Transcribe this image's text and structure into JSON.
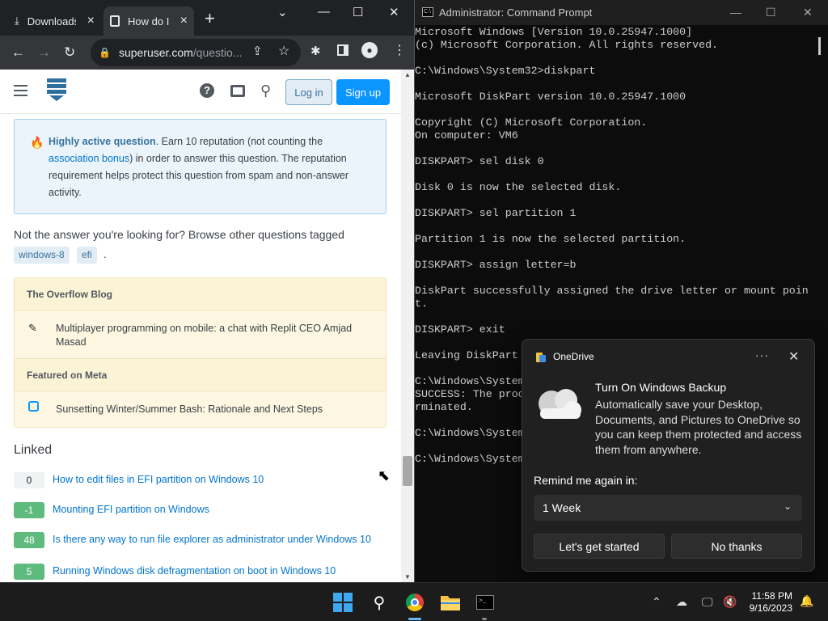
{
  "browser": {
    "tabs": [
      {
        "label": "Downloads",
        "icon": "download-icon"
      },
      {
        "label": "How do I",
        "icon": "superuser-icon"
      }
    ],
    "window_controls": {
      "minimize": "—",
      "maximize": "☐",
      "close": "✕"
    },
    "url": {
      "domain": "superuser.com",
      "path": "/questio..."
    }
  },
  "site_header": {
    "login": "Log in",
    "signup": "Sign up"
  },
  "notice": {
    "bold": "Highly active question",
    "text1": ". Earn 10 reputation (not counting the ",
    "link": "association bonus",
    "text2": ") in order to answer this question. The reputation requirement helps protect this question from spam and non-answer activity."
  },
  "browse": {
    "text": "Not the answer you're looking for? Browse other questions tagged",
    "tags": [
      "windows-8",
      "efi"
    ],
    "trailing": "."
  },
  "sidebar": {
    "blog_title": "The Overflow Blog",
    "blog_item": "Multiplayer programming on mobile: a chat with Replit CEO Amjad Masad",
    "meta_title": "Featured on Meta",
    "meta_item": "Sunsetting Winter/Summer Bash: Rationale and Next Steps"
  },
  "linked": {
    "heading": "Linked",
    "items": [
      {
        "score": "0",
        "title": "How to edit files in EFI partition on Windows 10"
      },
      {
        "score": "-1",
        "title": "Mounting EFI partition on Windows"
      },
      {
        "score": "48",
        "title": "Is there any way to run file explorer as administrator under Windows 10"
      },
      {
        "score": "5",
        "title": "Running Windows disk defragmentation on boot in Windows 10"
      }
    ]
  },
  "cmd": {
    "title": "Administrator: Command Prompt",
    "lines": [
      "Microsoft Windows [Version 10.0.25947.1000]",
      "(c) Microsoft Corporation. All rights reserved.",
      "",
      "C:\\Windows\\System32>diskpart",
      "",
      "Microsoft DiskPart version 10.0.25947.1000",
      "",
      "Copyright (C) Microsoft Corporation.",
      "On computer: VM6",
      "",
      "DISKPART> sel disk 0",
      "",
      "Disk 0 is now the selected disk.",
      "",
      "DISKPART> sel partition 1",
      "",
      "Partition 1 is now the selected partition.",
      "",
      "DISKPART> assign letter=b",
      "",
      "DiskPart successfully assigned the drive letter or mount poin",
      "t.",
      "",
      "DISKPART> exit",
      "",
      "Leaving DiskPart",
      "",
      "C:\\Windows\\System",
      "SUCCESS: The proc",
      "rminated.",
      "",
      "C:\\Windows\\System",
      "",
      "C:\\Windows\\System"
    ]
  },
  "toast": {
    "app": "OneDrive",
    "more": "···",
    "title": "Turn On Windows Backup",
    "body": "Automatically save your Desktop, Documents, and Pictures to OneDrive so you can keep them protected and access them from anywhere.",
    "remind_label": "Remind me again in:",
    "remind_value": "1 Week",
    "primary": "Let's get started",
    "secondary": "No thanks"
  },
  "taskbar": {
    "time": "11:58 PM",
    "date": "9/16/2023",
    "apps": [
      "windows-start-icon",
      "search-icon",
      "chrome-icon",
      "file-explorer-icon",
      "terminal-icon"
    ]
  },
  "colors": {
    "accent": "#0a95ff",
    "positive_score": "#5eba7d",
    "notice_bg": "#ebf4fb",
    "blog_bg": "#fbf3d5"
  }
}
